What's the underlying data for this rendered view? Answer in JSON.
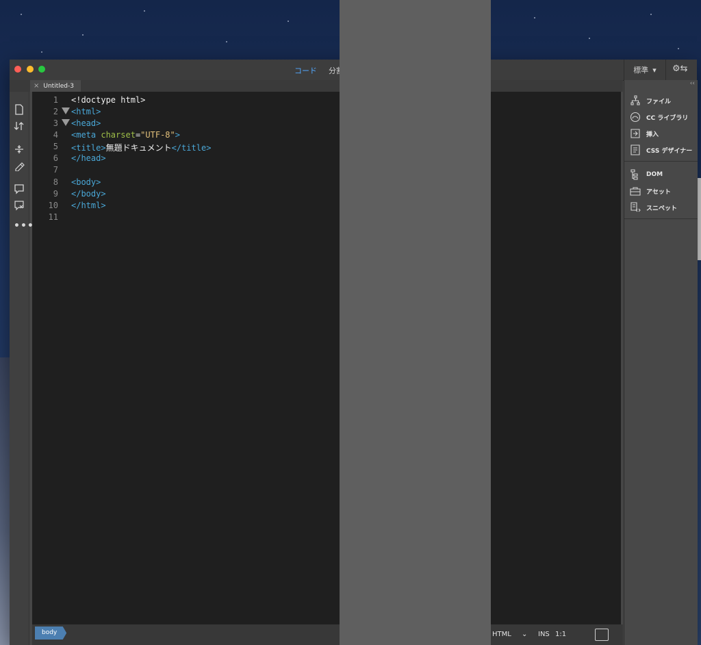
{
  "titlebar": {
    "tabs": [
      {
        "label": "コード",
        "active": true
      },
      {
        "label": "分割",
        "active": false
      }
    ],
    "workspace_label": "標準",
    "sync_icon": "gear-sync-icon"
  },
  "document": {
    "tab_title": "Untitled-3"
  },
  "editor": {
    "line_numbers": [
      "1",
      "2",
      "3",
      "4",
      "5",
      "6",
      "7",
      "8",
      "9",
      "10",
      "11"
    ],
    "lines": [
      "<!doctype html>",
      "<html>",
      "<head>",
      "<meta charset=\"UTF-8\">",
      "<title>無題ドキュメント</title>",
      "</head>",
      "",
      "<body>",
      "</body>",
      "</html>",
      ""
    ],
    "folded_lines": [
      2,
      3
    ],
    "colors": {
      "tag": "#4aa8d8",
      "attr": "#9fbf48",
      "string": "#e2c07b"
    }
  },
  "statusbar": {
    "breadcrumb": "body",
    "language": "HTML",
    "mode": "INS",
    "position": "1:1"
  },
  "right_panel": {
    "items": [
      {
        "label": "ファイル",
        "icon": "file-tree-icon"
      },
      {
        "label": "CC ライブラリ",
        "icon": "cc-libraries-icon"
      },
      {
        "label": "挿入",
        "icon": "insert-icon"
      },
      {
        "label": "CSS デザイナー",
        "icon": "css-designer-icon"
      },
      {
        "label": "DOM",
        "icon": "dom-icon"
      },
      {
        "label": "アセット",
        "icon": "assets-icon"
      },
      {
        "label": "スニペット",
        "icon": "snippets-icon"
      }
    ]
  }
}
